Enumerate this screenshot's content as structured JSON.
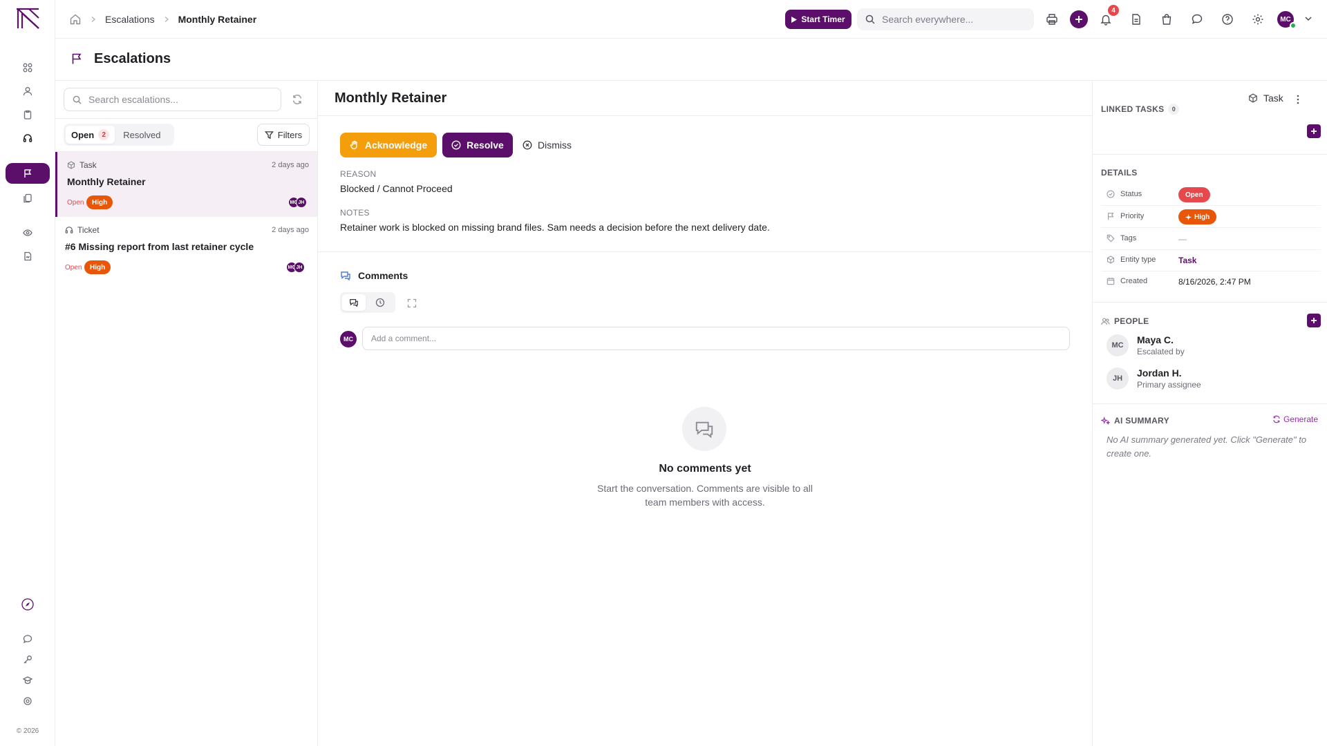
{
  "app": {
    "copyright": "© 2026"
  },
  "breadcrumb": {
    "items": [
      "Escalations",
      "Monthly Retainer"
    ]
  },
  "topbar": {
    "start_timer_label": "Start Timer",
    "search_placeholder": "Search everywhere...",
    "notification_count": "4",
    "user_initials": "MC"
  },
  "page": {
    "title": "Escalations"
  },
  "list": {
    "search_placeholder": "Search escalations...",
    "tabs": {
      "open_label": "Open",
      "open_count": "2",
      "resolved_label": "Resolved"
    },
    "filters_label": "Filters",
    "items": [
      {
        "type": "Task",
        "time": "2 days ago",
        "title": "Monthly Retainer",
        "status": "Open",
        "priority": "High",
        "avatars": [
          "MC",
          "JH"
        ]
      },
      {
        "type": "Ticket",
        "time": "2 days ago",
        "title": "#6 Missing report from last retainer cycle",
        "status": "Open",
        "priority": "High",
        "avatars": [
          "MC",
          "JH"
        ]
      }
    ]
  },
  "detail": {
    "title": "Monthly Retainer",
    "type_label": "Task",
    "actions": {
      "acknowledge": "Acknowledge",
      "resolve": "Resolve",
      "dismiss": "Dismiss"
    },
    "reason_label": "REASON",
    "reason_value": "Blocked / Cannot Proceed",
    "notes_label": "NOTES",
    "notes_value": "Retainer work is blocked on missing brand files. Sam needs a decision before the next delivery date.",
    "comments": {
      "heading": "Comments",
      "avatar_initials": "MC",
      "input_placeholder": "Add a comment...",
      "empty_title": "No comments yet",
      "empty_subtitle": "Start the conversation. Comments are visible to all team members with access."
    }
  },
  "sidebar": {
    "linked_tasks": {
      "title": "LINKED TASKS",
      "count": "0"
    },
    "details": {
      "title": "DETAILS",
      "rows": {
        "status": {
          "key": "Status",
          "value": "Open"
        },
        "priority": {
          "key": "Priority",
          "value": "High"
        },
        "tags": {
          "key": "Tags",
          "value": "—"
        },
        "entity_type": {
          "key": "Entity type",
          "value": "Task"
        },
        "created": {
          "key": "Created",
          "value": "8/16/2026, 2:47 PM"
        }
      }
    },
    "people": {
      "title": "PEOPLE",
      "items": [
        {
          "initials": "MC",
          "name": "Maya C.",
          "role": "Escalated by"
        },
        {
          "initials": "JH",
          "name": "Jordan H.",
          "role": "Primary assignee"
        }
      ]
    },
    "ai_summary": {
      "title": "AI SUMMARY",
      "generate_label": "Generate",
      "empty_text": "No AI summary generated yet. Click \"Generate\" to create one."
    }
  },
  "colors": {
    "brand": "#5b0f6b",
    "acknowledge": "#f59e0b",
    "priority_high": "#e8560a",
    "status_open": "#e5484d"
  }
}
